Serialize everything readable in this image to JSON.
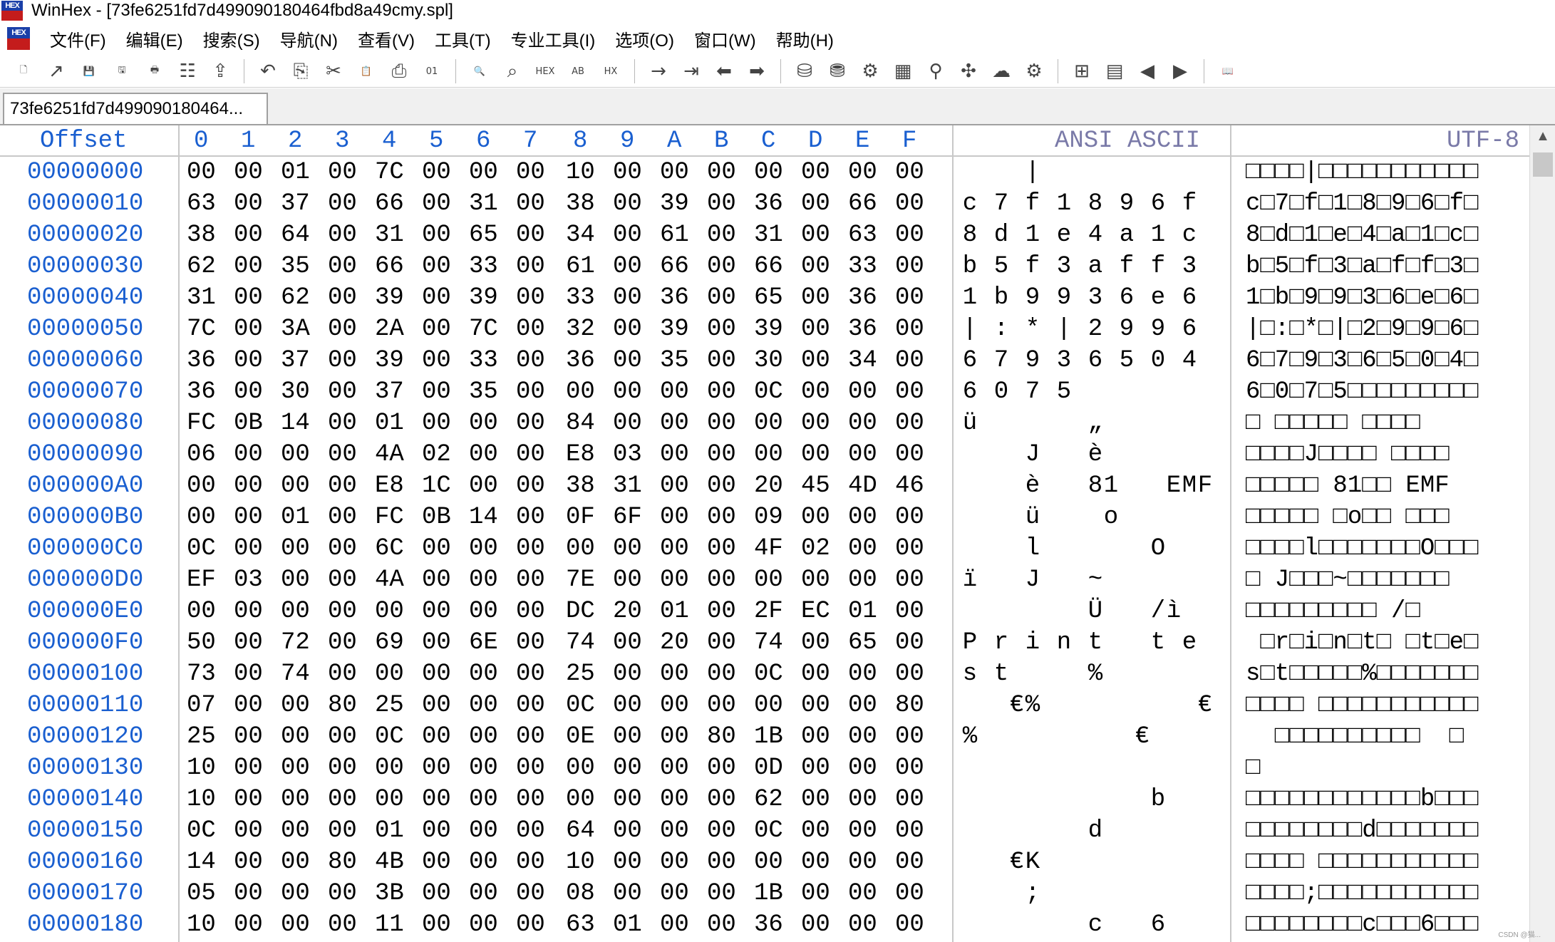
{
  "window": {
    "title": "WinHex - [73fe6251fd7d499090180464fbd8a49cmy.spl]",
    "logo_text": "HEX"
  },
  "menu": {
    "items": [
      "文件(F)",
      "编辑(E)",
      "搜索(S)",
      "导航(N)",
      "查看(V)",
      "工具(T)",
      "专业工具(I)",
      "选项(O)",
      "窗口(W)",
      "帮助(H)"
    ]
  },
  "toolbar": {
    "icons": [
      {
        "name": "new-file-icon",
        "glyph": "🗋"
      },
      {
        "name": "open-file-icon",
        "glyph": "↗"
      },
      {
        "name": "save-icon",
        "glyph": "💾"
      },
      {
        "name": "save-as-icon",
        "glyph": "🖫"
      },
      {
        "name": "print-icon",
        "glyph": "🖶"
      },
      {
        "name": "properties-icon",
        "glyph": "☷"
      },
      {
        "name": "export-icon",
        "glyph": "⇪"
      },
      {
        "sep": true
      },
      {
        "name": "undo-icon",
        "glyph": "↶"
      },
      {
        "name": "copy-icon",
        "glyph": "⎘"
      },
      {
        "name": "cut-icon",
        "glyph": "✂"
      },
      {
        "name": "paste-icon",
        "glyph": "📋"
      },
      {
        "name": "paste-write-icon",
        "glyph": "⎙"
      },
      {
        "name": "binary-icon",
        "glyph": "01"
      },
      {
        "sep": true
      },
      {
        "name": "find-text-icon",
        "glyph": "🔍"
      },
      {
        "name": "find-hex-icon",
        "glyph": "⌕"
      },
      {
        "name": "replace-hex-icon",
        "glyph": "HEX"
      },
      {
        "name": "replace-text-icon",
        "glyph": "AB"
      },
      {
        "name": "replace-hex2-icon",
        "glyph": "HX"
      },
      {
        "sep": true
      },
      {
        "name": "goto-offset-icon",
        "glyph": "→"
      },
      {
        "name": "goto-block-icon",
        "glyph": "⇥"
      },
      {
        "name": "back-icon",
        "glyph": "⬅"
      },
      {
        "name": "forward-icon",
        "glyph": "➡"
      },
      {
        "sep": true
      },
      {
        "name": "disk-icon",
        "glyph": "⛁"
      },
      {
        "name": "disk-open-icon",
        "glyph": "⛃"
      },
      {
        "name": "disk-tools-icon",
        "glyph": "⚙"
      },
      {
        "name": "memory-icon",
        "glyph": "▦"
      },
      {
        "name": "magnify-icon",
        "glyph": "⚲"
      },
      {
        "name": "puzzle-icon",
        "glyph": "✣"
      },
      {
        "name": "cloud-icon",
        "glyph": "☁"
      },
      {
        "name": "gear-icon",
        "glyph": "⚙"
      },
      {
        "sep": true
      },
      {
        "name": "settings-grid-icon",
        "glyph": "⊞"
      },
      {
        "name": "table-icon",
        "glyph": "▤"
      },
      {
        "name": "prev-arrow-icon",
        "glyph": "◀"
      },
      {
        "name": "next-arrow-icon",
        "glyph": "▶"
      },
      {
        "sep": true
      },
      {
        "name": "help-book-icon",
        "glyph": "📖"
      }
    ]
  },
  "tab": {
    "label": "73fe6251fd7d499090180464..."
  },
  "hex": {
    "offset_header": "Offset",
    "column_headers": [
      "0",
      "1",
      "2",
      "3",
      "4",
      "5",
      "6",
      "7",
      "8",
      "9",
      "A",
      "B",
      "C",
      "D",
      "E",
      "F"
    ],
    "ansi_header": "ANSI ASCII",
    "utf_header": "UTF-8",
    "rows": [
      {
        "offset": "00000000",
        "bytes": [
          "00",
          "00",
          "01",
          "00",
          "7C",
          "00",
          "00",
          "00",
          "10",
          "00",
          "00",
          "00",
          "00",
          "00",
          "00",
          "00"
        ],
        "ansi": [
          "",
          "",
          "",
          "",
          "|",
          "",
          "",
          "",
          "",
          "",
          "",
          "",
          "",
          "",
          "",
          ""
        ],
        "utf": "□□□□|□□□□□□□□□□□"
      },
      {
        "offset": "00000010",
        "bytes": [
          "63",
          "00",
          "37",
          "00",
          "66",
          "00",
          "31",
          "00",
          "38",
          "00",
          "39",
          "00",
          "36",
          "00",
          "66",
          "00"
        ],
        "ansi": [
          "c",
          "",
          "7",
          "",
          "f",
          "",
          "1",
          "",
          "8",
          "",
          "9",
          "",
          "6",
          "",
          "f",
          ""
        ],
        "utf": "c□7□f□1□8□9□6□f□"
      },
      {
        "offset": "00000020",
        "bytes": [
          "38",
          "00",
          "64",
          "00",
          "31",
          "00",
          "65",
          "00",
          "34",
          "00",
          "61",
          "00",
          "31",
          "00",
          "63",
          "00"
        ],
        "ansi": [
          "8",
          "",
          "d",
          "",
          "1",
          "",
          "e",
          "",
          "4",
          "",
          "a",
          "",
          "1",
          "",
          "c",
          ""
        ],
        "utf": "8□d□1□e□4□a□1□c□"
      },
      {
        "offset": "00000030",
        "bytes": [
          "62",
          "00",
          "35",
          "00",
          "66",
          "00",
          "33",
          "00",
          "61",
          "00",
          "66",
          "00",
          "66",
          "00",
          "33",
          "00"
        ],
        "ansi": [
          "b",
          "",
          "5",
          "",
          "f",
          "",
          "3",
          "",
          "a",
          "",
          "f",
          "",
          "f",
          "",
          "3",
          ""
        ],
        "utf": "b□5□f□3□a□f□f□3□"
      },
      {
        "offset": "00000040",
        "bytes": [
          "31",
          "00",
          "62",
          "00",
          "39",
          "00",
          "39",
          "00",
          "33",
          "00",
          "36",
          "00",
          "65",
          "00",
          "36",
          "00"
        ],
        "ansi": [
          "1",
          "",
          "b",
          "",
          "9",
          "",
          "9",
          "",
          "3",
          "",
          "6",
          "",
          "e",
          "",
          "6",
          ""
        ],
        "utf": "1□b□9□9□3□6□e□6□"
      },
      {
        "offset": "00000050",
        "bytes": [
          "7C",
          "00",
          "3A",
          "00",
          "2A",
          "00",
          "7C",
          "00",
          "32",
          "00",
          "39",
          "00",
          "39",
          "00",
          "36",
          "00"
        ],
        "ansi": [
          "|",
          "",
          ":",
          "",
          "*",
          "",
          "|",
          "",
          "2",
          "",
          "9",
          "",
          "9",
          "",
          "6",
          ""
        ],
        "utf": "|□:□*□|□2□9□9□6□"
      },
      {
        "offset": "00000060",
        "bytes": [
          "36",
          "00",
          "37",
          "00",
          "39",
          "00",
          "33",
          "00",
          "36",
          "00",
          "35",
          "00",
          "30",
          "00",
          "34",
          "00"
        ],
        "ansi": [
          "6",
          "",
          "7",
          "",
          "9",
          "",
          "3",
          "",
          "6",
          "",
          "5",
          "",
          "0",
          "",
          "4",
          ""
        ],
        "utf": "6□7□9□3□6□5□0□4□"
      },
      {
        "offset": "00000070",
        "bytes": [
          "36",
          "00",
          "30",
          "00",
          "37",
          "00",
          "35",
          "00",
          "00",
          "00",
          "00",
          "00",
          "0C",
          "00",
          "00",
          "00"
        ],
        "ansi": [
          "6",
          "",
          "0",
          "",
          "7",
          "",
          "5",
          "",
          "",
          "",
          "",
          "",
          "",
          "",
          "",
          ""
        ],
        "utf": "6□0□7□5□□□□□□□□□"
      },
      {
        "offset": "00000080",
        "bytes": [
          "FC",
          "0B",
          "14",
          "00",
          "01",
          "00",
          "00",
          "00",
          "84",
          "00",
          "00",
          "00",
          "00",
          "00",
          "00",
          "00"
        ],
        "ansi": [
          "ü",
          "",
          "",
          "",
          "",
          "",
          "",
          "",
          "„",
          "",
          "",
          "",
          "",
          "",
          "",
          ""
        ],
        "utf": "□ □□□□□ □□□□"
      },
      {
        "offset": "00000090",
        "bytes": [
          "06",
          "00",
          "00",
          "00",
          "4A",
          "02",
          "00",
          "00",
          "E8",
          "03",
          "00",
          "00",
          "00",
          "00",
          "00",
          "00"
        ],
        "ansi": [
          "",
          "",
          "",
          "",
          "J",
          "",
          "",
          "",
          "è",
          "",
          "",
          "",
          "",
          "",
          "",
          ""
        ],
        "utf": "□□□□J□□□□ □□□□"
      },
      {
        "offset": "000000A0",
        "bytes": [
          "00",
          "00",
          "00",
          "00",
          "E8",
          "1C",
          "00",
          "00",
          "38",
          "31",
          "00",
          "00",
          "20",
          "45",
          "4D",
          "46"
        ],
        "ansi": [
          "",
          "",
          "",
          "",
          "è",
          "",
          "",
          "",
          "8",
          "1",
          "",
          "",
          "",
          "E",
          "M",
          "F"
        ],
        "utf": "□□□□□ 81□□ EMF"
      },
      {
        "offset": "000000B0",
        "bytes": [
          "00",
          "00",
          "01",
          "00",
          "FC",
          "0B",
          "14",
          "00",
          "0F",
          "6F",
          "00",
          "00",
          "09",
          "00",
          "00",
          "00"
        ],
        "ansi": [
          "",
          "",
          "",
          "",
          "ü",
          "",
          "",
          "",
          "",
          "o",
          "",
          "",
          "",
          "",
          "",
          ""
        ],
        "utf": "□□□□□ □o□□ □□□"
      },
      {
        "offset": "000000C0",
        "bytes": [
          "0C",
          "00",
          "00",
          "00",
          "6C",
          "00",
          "00",
          "00",
          "00",
          "00",
          "00",
          "00",
          "4F",
          "02",
          "00",
          "00"
        ],
        "ansi": [
          "",
          "",
          "",
          "",
          "l",
          "",
          "",
          "",
          "",
          "",
          "",
          "",
          "O",
          "",
          "",
          ""
        ],
        "utf": "□□□□l□□□□□□□O□□□"
      },
      {
        "offset": "000000D0",
        "bytes": [
          "EF",
          "03",
          "00",
          "00",
          "4A",
          "00",
          "00",
          "00",
          "7E",
          "00",
          "00",
          "00",
          "00",
          "00",
          "00",
          "00"
        ],
        "ansi": [
          "ï",
          "",
          "",
          "",
          "J",
          "",
          "",
          "",
          "~",
          "",
          "",
          "",
          "",
          "",
          "",
          ""
        ],
        "utf": "□ J□□□~□□□□□□□"
      },
      {
        "offset": "000000E0",
        "bytes": [
          "00",
          "00",
          "00",
          "00",
          "00",
          "00",
          "00",
          "00",
          "DC",
          "20",
          "01",
          "00",
          "2F",
          "EC",
          "01",
          "00"
        ],
        "ansi": [
          "",
          "",
          "",
          "",
          "",
          "",
          "",
          "",
          "Ü",
          "",
          "",
          "",
          "/",
          "ì",
          "",
          ""
        ],
        "utf": "□□□□□□□□□ /□"
      },
      {
        "offset": "000000F0",
        "bytes": [
          "50",
          "00",
          "72",
          "00",
          "69",
          "00",
          "6E",
          "00",
          "74",
          "00",
          "20",
          "00",
          "74",
          "00",
          "65",
          "00"
        ],
        "ansi": [
          "P",
          "",
          "r",
          "",
          "i",
          "",
          "n",
          "",
          "t",
          "",
          "",
          "",
          "t",
          "",
          "e",
          ""
        ],
        "utf": " □r□i□n□t□ □t□e□"
      },
      {
        "offset": "00000100",
        "bytes": [
          "73",
          "00",
          "74",
          "00",
          "00",
          "00",
          "00",
          "00",
          "25",
          "00",
          "00",
          "00",
          "0C",
          "00",
          "00",
          "00"
        ],
        "ansi": [
          "s",
          "",
          "t",
          "",
          "",
          "",
          "",
          "",
          "%",
          "",
          "",
          "",
          "",
          "",
          "",
          ""
        ],
        "utf": "s□t□□□□□%□□□□□□□"
      },
      {
        "offset": "00000110",
        "bytes": [
          "07",
          "00",
          "00",
          "80",
          "25",
          "00",
          "00",
          "00",
          "0C",
          "00",
          "00",
          "00",
          "00",
          "00",
          "00",
          "80"
        ],
        "ansi": [
          "",
          "",
          "",
          "€",
          "%",
          "",
          "",
          "",
          "",
          "",
          "",
          "",
          "",
          "",
          "",
          "€"
        ],
        "utf": "□□□□ □□□□□□□□□□□"
      },
      {
        "offset": "00000120",
        "bytes": [
          "25",
          "00",
          "00",
          "00",
          "0C",
          "00",
          "00",
          "00",
          "0E",
          "00",
          "00",
          "80",
          "1B",
          "00",
          "00",
          "00"
        ],
        "ansi": [
          "%",
          "",
          "",
          "",
          "",
          "",
          "",
          "",
          "",
          "",
          "",
          "€",
          "",
          "",
          "",
          ""
        ],
        "utf": "  □□□□□□□□□□  □"
      },
      {
        "offset": "00000130",
        "bytes": [
          "10",
          "00",
          "00",
          "00",
          "00",
          "00",
          "00",
          "00",
          "00",
          "00",
          "00",
          "00",
          "0D",
          "00",
          "00",
          "00"
        ],
        "ansi": [
          "",
          "",
          "",
          "",
          "",
          "",
          "",
          "",
          "",
          "",
          "",
          "",
          "",
          "",
          "",
          ""
        ],
        "utf": "□"
      },
      {
        "offset": "00000140",
        "bytes": [
          "10",
          "00",
          "00",
          "00",
          "00",
          "00",
          "00",
          "00",
          "00",
          "00",
          "00",
          "00",
          "62",
          "00",
          "00",
          "00"
        ],
        "ansi": [
          "",
          "",
          "",
          "",
          "",
          "",
          "",
          "",
          "",
          "",
          "",
          "",
          "b",
          "",
          "",
          ""
        ],
        "utf": "□□□□□□□□□□□□b□□□"
      },
      {
        "offset": "00000150",
        "bytes": [
          "0C",
          "00",
          "00",
          "00",
          "01",
          "00",
          "00",
          "00",
          "64",
          "00",
          "00",
          "00",
          "0C",
          "00",
          "00",
          "00"
        ],
        "ansi": [
          "",
          "",
          "",
          "",
          "",
          "",
          "",
          "",
          "d",
          "",
          "",
          "",
          "",
          "",
          "",
          ""
        ],
        "utf": "□□□□□□□□d□□□□□□□"
      },
      {
        "offset": "00000160",
        "bytes": [
          "14",
          "00",
          "00",
          "80",
          "4B",
          "00",
          "00",
          "00",
          "10",
          "00",
          "00",
          "00",
          "00",
          "00",
          "00",
          "00"
        ],
        "ansi": [
          "",
          "",
          "",
          "€",
          "K",
          "",
          "",
          "",
          "",
          "",
          "",
          "",
          "",
          "",
          "",
          ""
        ],
        "utf": "□□□□ □□□□□□□□□□□"
      },
      {
        "offset": "00000170",
        "bytes": [
          "05",
          "00",
          "00",
          "00",
          "3B",
          "00",
          "00",
          "00",
          "08",
          "00",
          "00",
          "00",
          "1B",
          "00",
          "00",
          "00"
        ],
        "ansi": [
          "",
          "",
          "",
          "",
          ";",
          "",
          "",
          "",
          "",
          "",
          "",
          "",
          "",
          "",
          "",
          ""
        ],
        "utf": "□□□□;□□□□□□□□□□□"
      },
      {
        "offset": "00000180",
        "bytes": [
          "10",
          "00",
          "00",
          "00",
          "11",
          "00",
          "00",
          "00",
          "63",
          "01",
          "00",
          "00",
          "36",
          "00",
          "00",
          "00"
        ],
        "ansi": [
          "",
          "",
          "",
          "",
          "",
          "",
          "",
          "",
          "c",
          "",
          "",
          "",
          "6",
          "",
          "",
          ""
        ],
        "utf": "□□□□□□□□c□□□6□□□"
      }
    ]
  },
  "watermark": "CSDN @猫..."
}
